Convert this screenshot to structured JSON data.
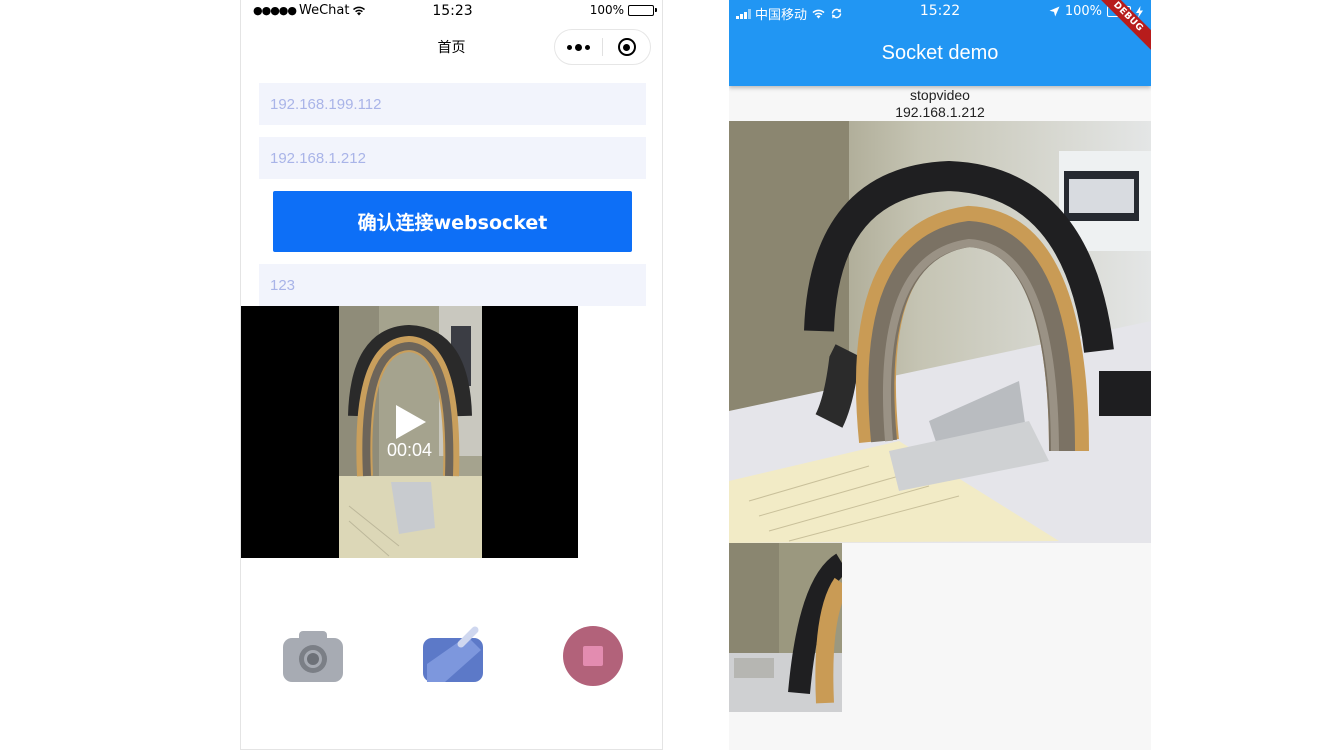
{
  "left_phone": {
    "status_bar": {
      "signal_dots": "●●●●●",
      "carrier": "WeChat",
      "time": "15:23",
      "battery_percent": "100%"
    },
    "nav": {
      "title": "首页"
    },
    "inputs": {
      "server_ip": {
        "placeholder": "192.168.199.112"
      },
      "client_ip": {
        "placeholder": "192.168.1.212"
      },
      "message": {
        "placeholder": "123"
      }
    },
    "connect_button": {
      "label": "确认连接websocket",
      "color": "#0d6ff7"
    },
    "video": {
      "time": "00:04"
    },
    "toolbar": [
      {
        "name": "camera-icon"
      },
      {
        "name": "edit-icon"
      },
      {
        "name": "stop-record-icon"
      }
    ]
  },
  "right_phone": {
    "status_bar": {
      "carrier": "中国移动",
      "time": "15:22",
      "battery_percent": "100%"
    },
    "app_bar": {
      "title": "Socket demo",
      "color": "#2196f3"
    },
    "debug_banner": "DEBUG",
    "status_label": "stopvideo",
    "ip_label": "192.168.1.212"
  }
}
